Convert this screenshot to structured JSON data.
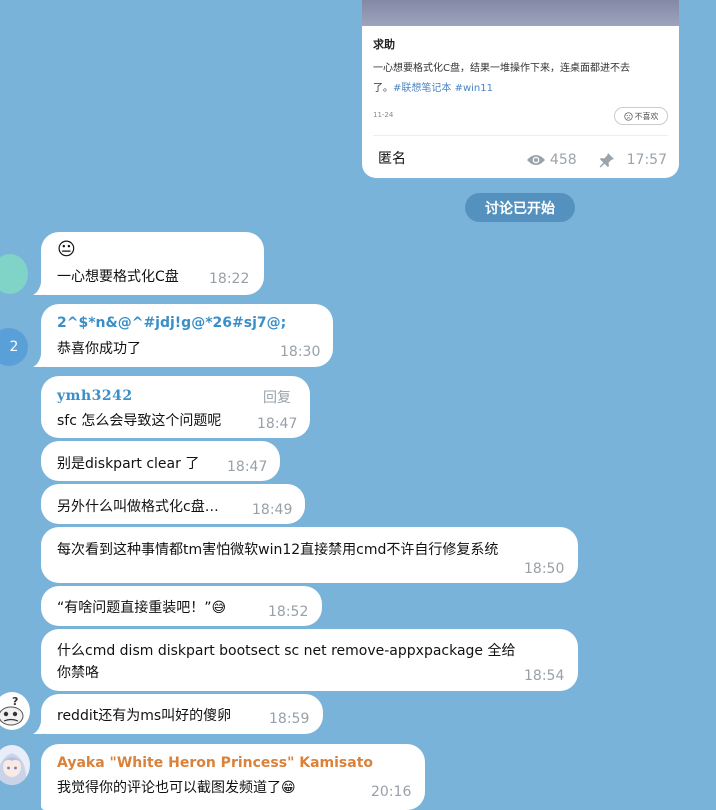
{
  "post": {
    "title": "求助",
    "body_line1": "一心想要格式化C盘，结果一堆操作下来，连桌面都进不去",
    "body_line2_prefix": "了。",
    "tag1": "#联想笔记本",
    "tag2": "#win11",
    "date": "11-24",
    "dislike_label": "不喜欢",
    "author": "匿名",
    "views": "458",
    "time": "17:57"
  },
  "service_pill": "讨论已开始",
  "messages": [
    {
      "emoji": "😐",
      "text": "一心想要格式化C盘",
      "time": "18:22"
    },
    {
      "sender": "2^$*n&@^#jdj!g@*26#sj7@;",
      "text": "恭喜你成功了",
      "time": "18:30",
      "avatar_count": "2"
    },
    {
      "sender": "ymh3242",
      "reply": "回复",
      "text": "sfc 怎么会导致这个问题呢",
      "time": "18:47"
    },
    {
      "text": "别是diskpart clear 了",
      "time": "18:47"
    },
    {
      "text": "另外什么叫做格式化c盘…",
      "time": "18:49"
    },
    {
      "text": "每次看到这种事情都tm害怕微软win12直接禁用cmd不许自行修复系统",
      "time": "18:50"
    },
    {
      "text": "“有啥问题直接重装吧！”😅",
      "time": "18:52"
    },
    {
      "text_line1": "什么cmd dism diskpart bootsect sc net remove-appxpackage 全给",
      "text_line2": "你禁咯",
      "time": "18:54"
    },
    {
      "text": "reddit还有为ms叫好的傻卵",
      "time": "18:59"
    },
    {
      "sender": "Ayaka \"White Heron Princess\" Kamisato",
      "text": "我觉得你的评论也可以截图发频道了😁",
      "time": "20:16"
    }
  ],
  "colors": {
    "background": "#7ab3d9",
    "bubble": "#ffffff",
    "sender_blue": "#3a8fc8",
    "sender_orange": "#d9823b",
    "time": "#98a1a8",
    "service_pill": "#4885b4",
    "avatar_teal": "#7fd3c7",
    "avatar_count_blue": "#5aa0d8"
  },
  "icons": [
    "eye-icon",
    "pin-icon",
    "dislike-face-icon",
    "confused-meme-avatar",
    "anime-girl-avatar"
  ]
}
